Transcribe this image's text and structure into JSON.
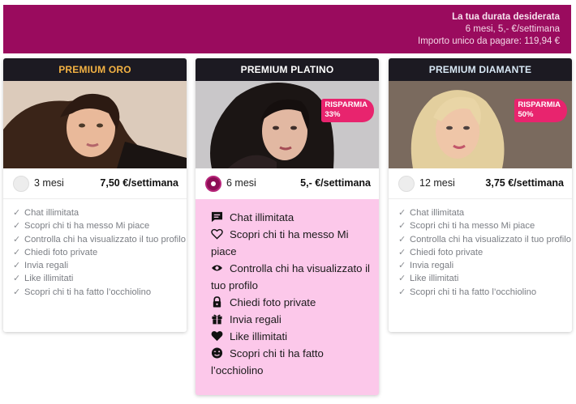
{
  "summary": {
    "title": "La tua durata desiderata",
    "line2": "6 mesi, 5,- €/settimana",
    "line3": "Importo unico da pagare: 119,94 €"
  },
  "plans": [
    {
      "name": "PREMIUM ORO",
      "name_color": "#f3b243",
      "months": "3 mesi",
      "price": "7,50 €/settimana",
      "selected": false,
      "features": [
        "Chat illimitata",
        "Scopri chi ti ha messo Mi piace",
        "Controlla chi ha visualizzato il tuo profilo",
        "Chiedi foto private",
        "Invia regali",
        "Like illimitati",
        "Scopri chi ti ha fatto l’occhiolino"
      ]
    },
    {
      "name": "PREMIUM PLATINO",
      "name_color": "#ffffff",
      "badge_line1": "RISPARMIA",
      "badge_line2": "33%",
      "months": "6 mesi",
      "price": "5,- €/settimana",
      "selected": true,
      "features": [
        {
          "icon": "chat-icon",
          "label": "Chat illimitata"
        },
        {
          "icon": "heart-outline-icon",
          "label": "Scopri chi ti ha messo Mi piace"
        },
        {
          "icon": "eye-icon",
          "label": "Controlla chi ha visualizzato il tuo profilo"
        },
        {
          "icon": "lock-icon",
          "label": "Chiedi foto private"
        },
        {
          "icon": "gift-icon",
          "label": "Invia regali"
        },
        {
          "icon": "heart-filled-icon",
          "label": "Like illimitati"
        },
        {
          "icon": "wink-icon",
          "label": "Scopri chi ti ha fatto l’occhiolino"
        }
      ]
    },
    {
      "name": "PREMIUM DIAMANTE",
      "name_color": "#d8e8f5",
      "badge_line1": "RISPARMIA",
      "badge_line2": "50%",
      "months": "12 mesi",
      "price": "3,75 €/settimana",
      "selected": false,
      "features": [
        "Chat illimitata",
        "Scopri chi ti ha messo Mi piace",
        "Controlla chi ha visualizzato il tuo profilo",
        "Chiedi foto private",
        "Invia regali",
        "Like illimitati",
        "Scopri chi ti ha fatto l’occhiolino"
      ]
    }
  ],
  "check_glyph": "✓",
  "colors": {
    "banner": "#9a0b5e",
    "selected_card": "#fcc8ea",
    "badge": "#e8246e",
    "radio_selected": "#8d0d55"
  }
}
